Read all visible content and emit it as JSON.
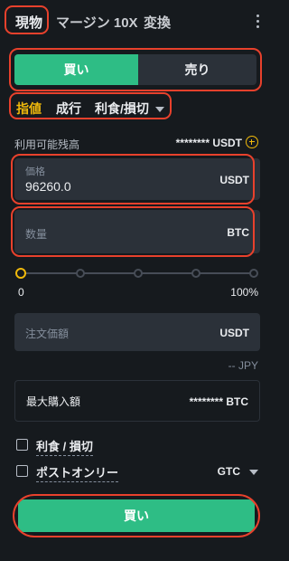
{
  "tabs": [
    {
      "label": "現物"
    },
    {
      "label": "マージン 10X"
    },
    {
      "label": "変換"
    }
  ],
  "side_toggle": {
    "buy_label": "買い",
    "sell_label": "売り"
  },
  "order_types": [
    {
      "label": "指値"
    },
    {
      "label": "成行"
    },
    {
      "label": "利食/損切"
    }
  ],
  "available": {
    "label": "利用可能残高",
    "value": "******** USDT"
  },
  "price": {
    "label": "価格",
    "value": "96260.0",
    "unit": "USDT"
  },
  "quantity": {
    "placeholder": "数量",
    "unit": "BTC"
  },
  "slider": {
    "min_label": "0",
    "max_label": "100%",
    "percent": 0
  },
  "order_amount": {
    "placeholder": "注文価額",
    "unit": "USDT",
    "fiat": "-- JPY"
  },
  "max_buy": {
    "label": "最大購入額",
    "value": "******** BTC"
  },
  "options": {
    "tp_sl_label": "利食 / 損切",
    "post_only_label": "ポストオンリー",
    "tif_value": "GTC"
  },
  "submit": {
    "label": "買い"
  },
  "colors": {
    "buy": "#2ebd85",
    "accent": "#f0b90b",
    "highlight": "#e8412c",
    "bg": "#161a1e",
    "field": "#2b3139"
  },
  "icons": {
    "more": "vertical-ellipsis-icon",
    "add": "plus-circle-icon",
    "dropdown": "chevron-down-icon",
    "checkbox": "checkbox-icon"
  }
}
